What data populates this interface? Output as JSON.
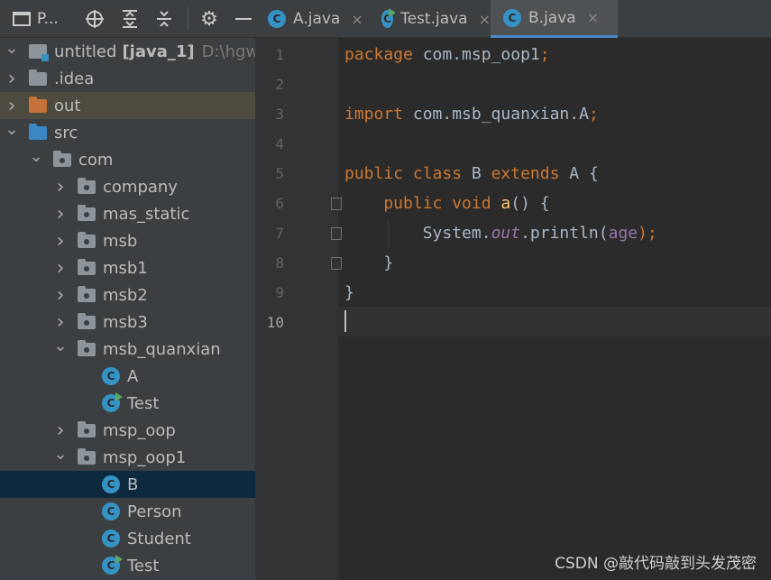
{
  "project_panel": {
    "title": "P...",
    "toolbar_icons": [
      "panel-icon",
      "locate-icon",
      "expand-all-icon",
      "collapse-all-icon",
      "gear-icon",
      "hide-icon"
    ],
    "tree": [
      {
        "label": "untitled",
        "module": "[java_1]",
        "path": "D:\\hgwz\\un",
        "type": "project",
        "arrow": "down",
        "depth": 0
      },
      {
        "label": ".idea",
        "type": "folder-grey",
        "arrow": "right",
        "depth": 0
      },
      {
        "label": "out",
        "type": "folder-orange",
        "arrow": "right",
        "depth": 0
      },
      {
        "label": "src",
        "type": "folder-blue",
        "arrow": "down",
        "depth": 0
      },
      {
        "label": "com",
        "type": "package",
        "arrow": "down",
        "depth": 1
      },
      {
        "label": "company",
        "type": "package",
        "arrow": "right",
        "depth": 2
      },
      {
        "label": "mas_static",
        "type": "package",
        "arrow": "right",
        "depth": 2
      },
      {
        "label": "msb",
        "type": "package",
        "arrow": "right",
        "depth": 2
      },
      {
        "label": "msb1",
        "type": "package",
        "arrow": "right",
        "depth": 2
      },
      {
        "label": "msb2",
        "type": "package",
        "arrow": "right",
        "depth": 2
      },
      {
        "label": "msb3",
        "type": "package",
        "arrow": "right",
        "depth": 2
      },
      {
        "label": "msb_quanxian",
        "type": "package",
        "arrow": "down",
        "depth": 2
      },
      {
        "label": "A",
        "type": "class",
        "depth": 3
      },
      {
        "label": "Test",
        "type": "class-run",
        "depth": 3
      },
      {
        "label": "msp_oop",
        "type": "package",
        "arrow": "right",
        "depth": 2
      },
      {
        "label": "msp_oop1",
        "type": "package",
        "arrow": "down",
        "depth": 2
      },
      {
        "label": "B",
        "type": "class",
        "depth": 3
      },
      {
        "label": "Person",
        "type": "class",
        "depth": 3
      },
      {
        "label": "Student",
        "type": "class",
        "depth": 3
      },
      {
        "label": "Test",
        "type": "class-run",
        "depth": 3
      }
    ]
  },
  "tabs": [
    {
      "label": "A.java",
      "icon": "class",
      "close": "×"
    },
    {
      "label": "Test.java",
      "icon": "class-run",
      "close": "×"
    },
    {
      "label": "B.java",
      "icon": "class",
      "close": "×",
      "active": true
    }
  ],
  "editor": {
    "line_numbers": [
      "1",
      "2",
      "3",
      "4",
      "5",
      "6",
      "7",
      "8",
      "9",
      "10"
    ],
    "code": [
      [
        {
          "t": "package ",
          "c": "kw"
        },
        {
          "t": "com.msp_oop1",
          "c": ""
        },
        {
          "t": ";",
          "c": "kw"
        }
      ],
      [],
      [
        {
          "t": "import ",
          "c": "kw"
        },
        {
          "t": "com.msb_quanxian.A",
          "c": ""
        },
        {
          "t": ";",
          "c": "kw"
        }
      ],
      [],
      [
        {
          "t": "public class ",
          "c": "kw"
        },
        {
          "t": "B ",
          "c": ""
        },
        {
          "t": "extends ",
          "c": "kw"
        },
        {
          "t": "A {",
          "c": ""
        }
      ],
      [
        {
          "t": "    public void ",
          "c": "kw"
        },
        {
          "t": "a",
          "c": "fn"
        },
        {
          "t": "() {",
          "c": ""
        }
      ],
      [
        {
          "t": "        System.",
          "c": ""
        },
        {
          "t": "out",
          "c": "it"
        },
        {
          "t": ".println(",
          "c": ""
        },
        {
          "t": "age",
          "c": "cn"
        },
        {
          "t": ");",
          "c": "kw"
        }
      ],
      [
        {
          "t": "    }",
          "c": ""
        }
      ],
      [
        {
          "t": "}",
          "c": ""
        }
      ],
      []
    ]
  },
  "watermark": "CSDN @敲代码敲到头发茂密"
}
